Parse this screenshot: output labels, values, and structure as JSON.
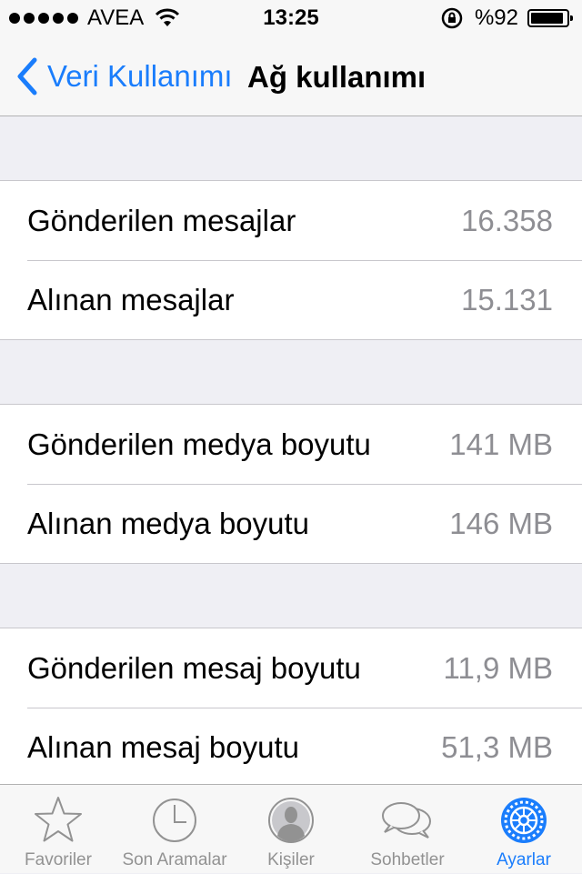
{
  "status_bar": {
    "carrier": "AVEA",
    "time": "13:25",
    "battery_text": "%92",
    "battery_level": 0.92
  },
  "nav": {
    "back_label": "Veri Kullanımı",
    "title": "Ağ kullanımı"
  },
  "groups": [
    {
      "rows": [
        {
          "label": "Gönderilen mesajlar",
          "value": "16.358"
        },
        {
          "label": "Alınan mesajlar",
          "value": "15.131"
        }
      ]
    },
    {
      "rows": [
        {
          "label": "Gönderilen medya boyutu",
          "value": "141 MB"
        },
        {
          "label": "Alınan medya boyutu",
          "value": "146 MB"
        }
      ]
    },
    {
      "rows": [
        {
          "label": "Gönderilen mesaj boyutu",
          "value": "11,9 MB"
        },
        {
          "label": "Alınan mesaj boyutu",
          "value": "51,3 MB"
        }
      ]
    }
  ],
  "tabs": [
    {
      "label": "Favoriler",
      "icon": "star-icon"
    },
    {
      "label": "Son Aramalar",
      "icon": "clock-icon"
    },
    {
      "label": "Kişiler",
      "icon": "person-icon"
    },
    {
      "label": "Sohbetler",
      "icon": "chat-bubbles-icon"
    },
    {
      "label": "Ayarlar",
      "icon": "gear-icon",
      "active": true
    }
  ],
  "colors": {
    "accent": "#1a7dfc",
    "inactive_tab": "#929292",
    "value_gray": "#8e8e93",
    "background": "#efeff4"
  }
}
